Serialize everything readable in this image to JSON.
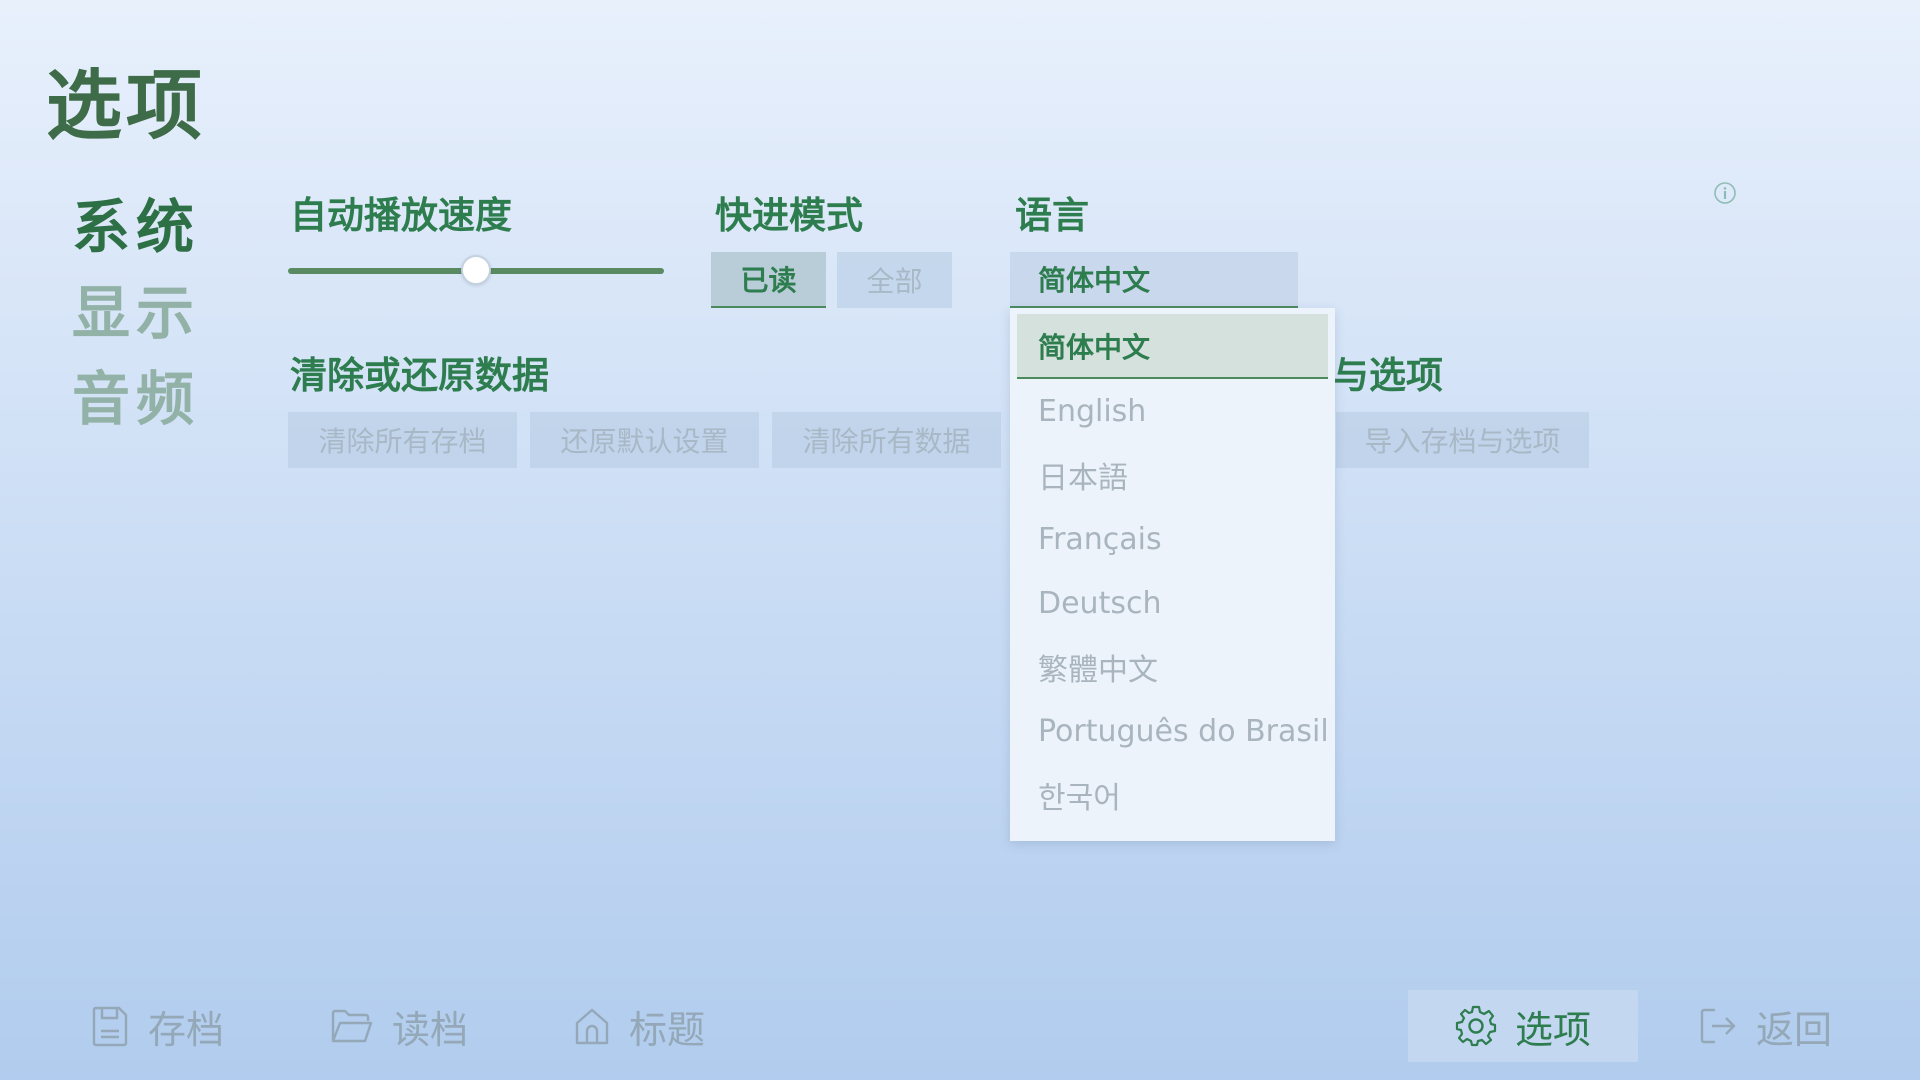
{
  "page": {
    "title": "选项"
  },
  "categories": [
    {
      "label": "系统",
      "active": true
    },
    {
      "label": "显示",
      "active": false
    },
    {
      "label": "音频",
      "active": false
    }
  ],
  "auto_speed": {
    "title": "自动播放速度",
    "value_fraction": 0.5
  },
  "skip_mode": {
    "title": "快进模式",
    "options": [
      "已读",
      "全部"
    ],
    "selected": "已读"
  },
  "language": {
    "title": "语言",
    "selected": "简体中文",
    "options": [
      "简体中文",
      "English",
      "日本語",
      "Français",
      "Deutsch",
      "繁體中文",
      "Português do Brasil",
      "한국어"
    ]
  },
  "data": {
    "title": "清除或还原数据",
    "buttons": [
      "清除所有存档",
      "还原默认设置",
      "清除所有数据"
    ]
  },
  "import": {
    "title_visible": "与选项",
    "button": "导入存档与选项"
  },
  "bottom_nav": [
    {
      "label": "存档",
      "icon": "save-icon"
    },
    {
      "label": "读档",
      "icon": "folder-icon"
    },
    {
      "label": "标题",
      "icon": "home-icon"
    },
    {
      "label": "选项",
      "icon": "gear-icon",
      "active": true
    },
    {
      "label": "返回",
      "icon": "exit-icon"
    }
  ],
  "colors": {
    "accent": "#2e7d4f",
    "dim_text": "#a8b8c6",
    "background_top": "#e8f0fc",
    "background_bottom": "#b1ccee"
  }
}
